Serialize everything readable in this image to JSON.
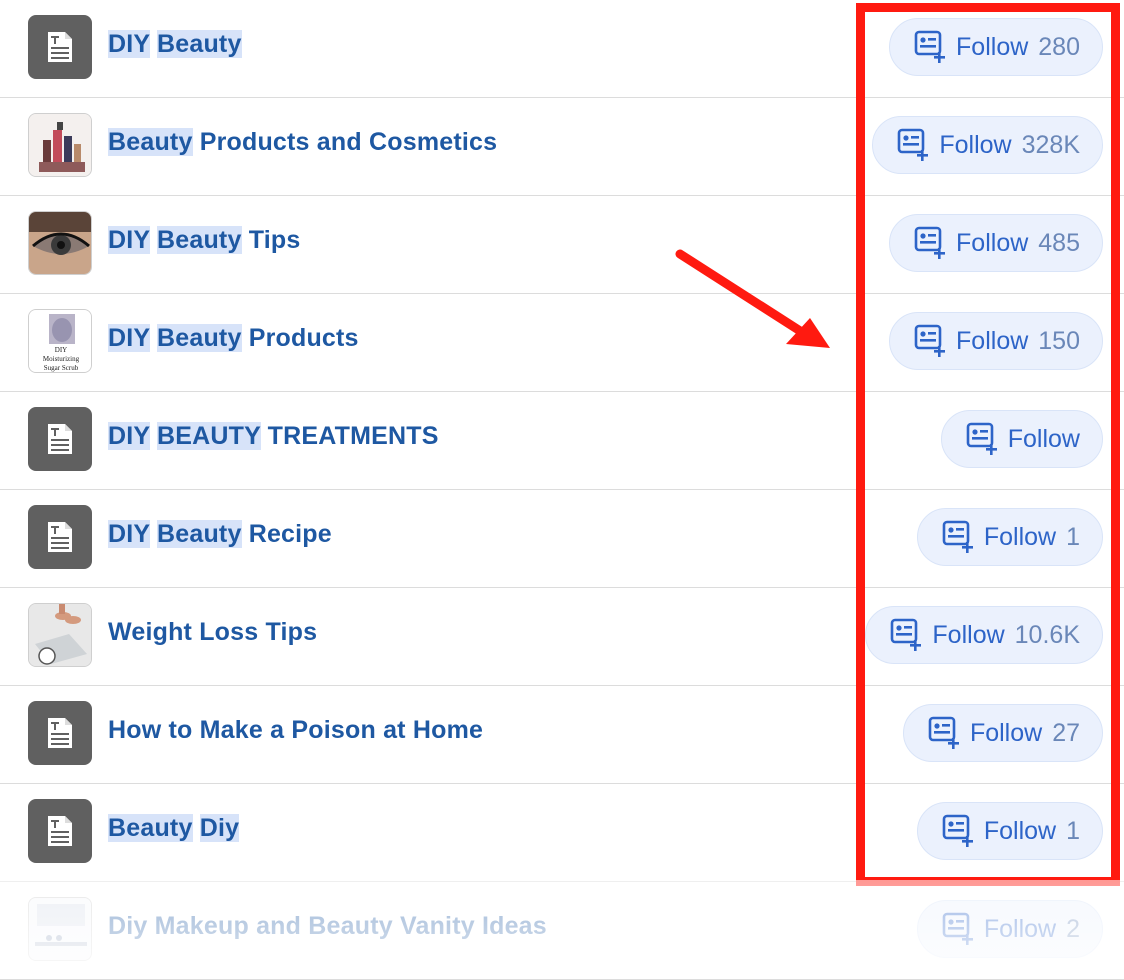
{
  "accent_color": "#1e58a2",
  "follow_color": "#2d64c8",
  "annotation_color": "#ff1a10",
  "boards": [
    {
      "title_parts": [
        {
          "text": "DIY",
          "hl": true
        },
        {
          "text": " ",
          "hl": false
        },
        {
          "text": "Beauty",
          "hl": true
        }
      ],
      "thumb": "doc-icon",
      "follow_label": "Follow",
      "follow_count": "280"
    },
    {
      "title_parts": [
        {
          "text": "Beauty",
          "hl": true
        },
        {
          "text": " Products and Cosmetics",
          "hl": false
        }
      ],
      "thumb": "cosmetics-photo",
      "follow_label": "Follow",
      "follow_count": "328K"
    },
    {
      "title_parts": [
        {
          "text": "DIY",
          "hl": true
        },
        {
          "text": " ",
          "hl": false
        },
        {
          "text": "Beauty",
          "hl": true
        },
        {
          "text": " Tips",
          "hl": false
        }
      ],
      "thumb": "eye-makeup-photo",
      "follow_label": "Follow",
      "follow_count": "485"
    },
    {
      "title_parts": [
        {
          "text": "DIY",
          "hl": true
        },
        {
          "text": " ",
          "hl": false
        },
        {
          "text": "Beauty",
          "hl": true
        },
        {
          "text": " Products",
          "hl": false
        }
      ],
      "thumb": "sugar-scrub-photo",
      "thumb_text": [
        "DIY",
        "Moisturizing",
        "Sugar Scrub"
      ],
      "follow_label": "Follow",
      "follow_count": "150"
    },
    {
      "title_parts": [
        {
          "text": "DIY",
          "hl": true
        },
        {
          "text": " ",
          "hl": false
        },
        {
          "text": "BEAUTY",
          "hl": true
        },
        {
          "text": " TREATMENTS",
          "hl": false
        }
      ],
      "thumb": "doc-icon",
      "follow_label": "Follow",
      "follow_count": ""
    },
    {
      "title_parts": [
        {
          "text": "DIY",
          "hl": true
        },
        {
          "text": " ",
          "hl": false
        },
        {
          "text": "Beauty",
          "hl": true
        },
        {
          "text": " Recipe",
          "hl": false
        }
      ],
      "thumb": "doc-icon",
      "follow_label": "Follow",
      "follow_count": "1"
    },
    {
      "title_parts": [
        {
          "text": "Weight Loss Tips",
          "hl": false
        }
      ],
      "thumb": "scale-photo",
      "follow_label": "Follow",
      "follow_count": "10.6K"
    },
    {
      "title_parts": [
        {
          "text": "How to Make a Poison at Home",
          "hl": false
        }
      ],
      "thumb": "doc-icon",
      "follow_label": "Follow",
      "follow_count": "27"
    },
    {
      "title_parts": [
        {
          "text": "Beauty",
          "hl": true
        },
        {
          "text": " ",
          "hl": false
        },
        {
          "text": "Diy",
          "hl": true
        }
      ],
      "thumb": "doc-icon",
      "follow_label": "Follow",
      "follow_count": "1"
    },
    {
      "title_parts": [
        {
          "text": "Diy Makeup and Beauty Vanity Ideas",
          "hl": false
        }
      ],
      "thumb": "vanity-photo",
      "follow_label": "Follow",
      "follow_count": "2"
    }
  ]
}
